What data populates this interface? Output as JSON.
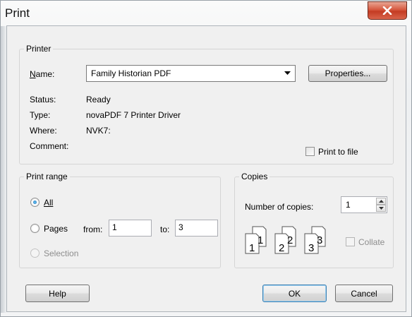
{
  "window": {
    "title": "Print"
  },
  "printer": {
    "group_label": "Printer",
    "name_label": "Name:",
    "name_value": "Family Historian PDF",
    "properties_button": "Properties...",
    "status_label": "Status:",
    "status_value": "Ready",
    "type_label": "Type:",
    "type_value": "novaPDF 7 Printer Driver",
    "where_label": "Where:",
    "where_value": "NVK7:",
    "comment_label": "Comment:",
    "print_to_file_label": "Print to file",
    "print_to_file_checked": false
  },
  "print_range": {
    "group_label": "Print range",
    "all_label": "All",
    "pages_label": "Pages",
    "from_label": "from:",
    "from_value": "1",
    "to_label": "to:",
    "to_value": "3",
    "selection_label": "Selection",
    "selected": "All"
  },
  "copies": {
    "group_label": "Copies",
    "number_label": "Number of copies:",
    "number_value": "1",
    "collate_label": "Collate",
    "collate_checked": false,
    "page_sets": [
      "1",
      "1",
      "2",
      "2",
      "3",
      "3"
    ]
  },
  "buttons": {
    "help": "Help",
    "ok": "OK",
    "cancel": "Cancel"
  },
  "icons": {
    "close": "close-icon",
    "dropdown": "chevron-down-icon",
    "spin_up": "arrow-up-icon",
    "spin_down": "arrow-down-icon",
    "collate": "document-stack-icon"
  },
  "colors": {
    "close_button": "#c43c23",
    "default_button_border": "#3c7fb1"
  }
}
